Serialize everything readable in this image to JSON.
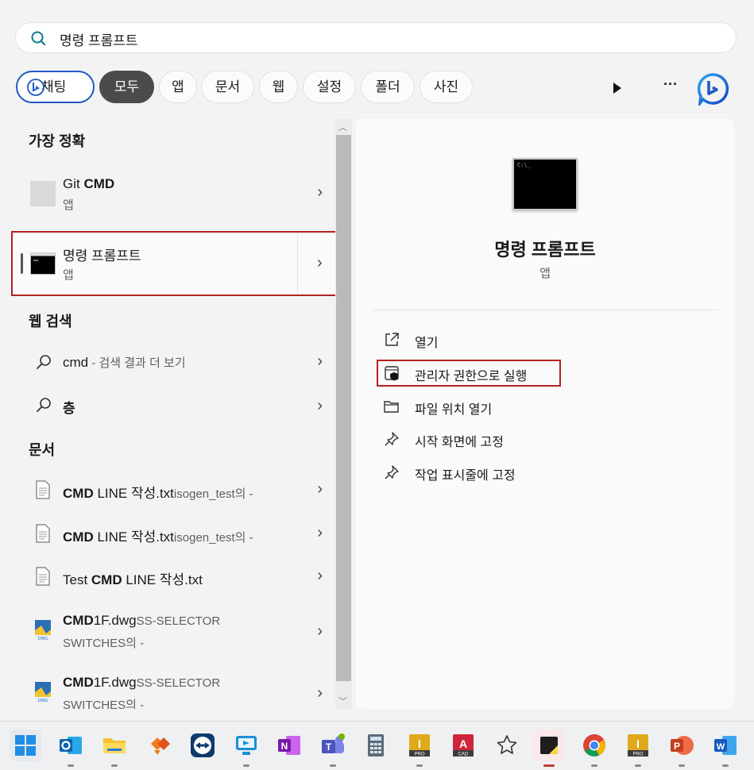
{
  "search": {
    "query": "명령 프롬프트"
  },
  "filters": {
    "chat": "채팅",
    "all": "모두",
    "apps": "앱",
    "documents": "문서",
    "web": "웹",
    "settings": "설정",
    "folders": "폴더",
    "photos": "사진",
    "more": "···"
  },
  "best_match": {
    "title": "가장 정확",
    "items": [
      {
        "name_plain": "Git ",
        "name_bold": "CMD",
        "type": "앱"
      },
      {
        "name_plain": "명령 프롬프트",
        "type": "앱"
      }
    ]
  },
  "web_search": {
    "title": "웹 검색",
    "items": [
      {
        "query": "cmd",
        "suffix": " - 검색 결과 더 보기"
      },
      {
        "query": "층"
      }
    ]
  },
  "documents": {
    "title": "문서",
    "items": [
      {
        "bold": "CMD",
        "plain": " LINE 작성.txt",
        "small": "isogen_test의 -"
      },
      {
        "bold": "CMD",
        "plain": " LINE 작성.txt",
        "small": "isogen_test의 -"
      },
      {
        "pre": "Test ",
        "bold": "CMD",
        "plain": " LINE 작성.txt"
      },
      {
        "bold": "CMD",
        "plain": "1F.dwg",
        "small": "SS-SELECTOR",
        "line2": "SWITCHES의 -"
      },
      {
        "bold": "CMD",
        "plain": "1F.dwg",
        "small": "SS-SELECTOR",
        "line2": "SWITCHES의 -"
      }
    ]
  },
  "preview": {
    "app_name": "명령 프롬프트",
    "app_type": "앱",
    "icon_text": "C:\\_",
    "actions": [
      {
        "label": "열기",
        "icon": "open-external-icon"
      },
      {
        "label": "관리자 권한으로 실행",
        "icon": "shield-icon"
      },
      {
        "label": "파일 위치 열기",
        "icon": "folder-icon"
      },
      {
        "label": "시작 화면에 고정",
        "icon": "pin-icon"
      },
      {
        "label": "작업 표시줄에 고정",
        "icon": "pin-icon"
      }
    ]
  },
  "taskbar": {
    "apps": [
      "start",
      "outlook",
      "file-explorer",
      "filezilla",
      "teamviewer",
      "remote-desktop",
      "onenote",
      "teams",
      "calculator",
      "inventor-pro",
      "autocad",
      "favorites",
      "sticky-notes",
      "chrome",
      "inventor-pro-2",
      "powerpoint",
      "word"
    ],
    "badges": {
      "pro": "PRO",
      "cad": "CAD",
      "inventor": "I",
      "autocad": "A",
      "onenote": "N",
      "teams": "T",
      "powerpoint": "P",
      "word": "W"
    }
  },
  "colors": {
    "accent": "#1f58c5",
    "highlight_border": "#b32222",
    "active_chip": "#4b4b4b"
  }
}
